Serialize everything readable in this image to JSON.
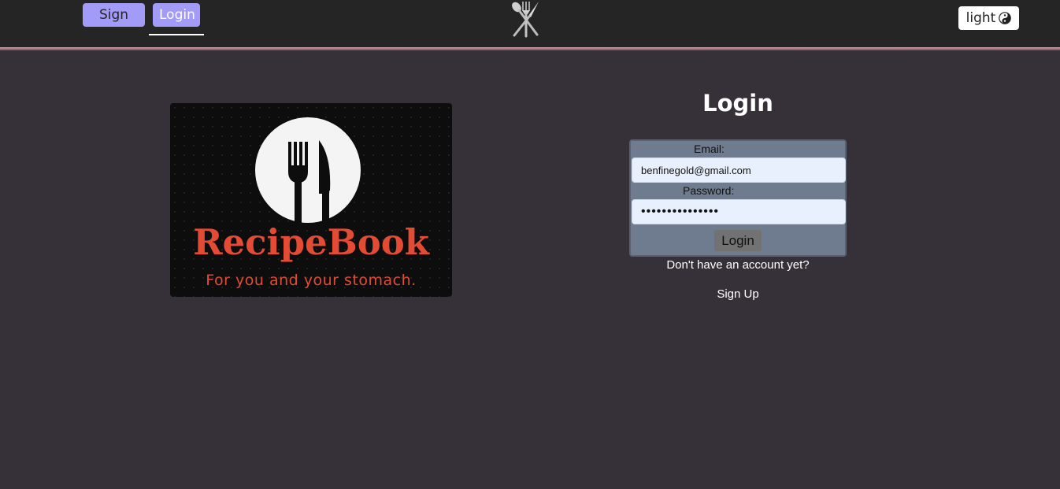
{
  "nav": {
    "signup_label": "Sign Up",
    "login_label": "Login",
    "logo_icon": "fork-knife-spoon-icon",
    "theme_label": "light",
    "theme_icon": "yin-yang-icon"
  },
  "brand": {
    "name": "RecipeBook",
    "tagline": "For you and your stomach.",
    "icon": "plate-fork-knife-icon",
    "accent_color": "#e34b34"
  },
  "login": {
    "title": "Login",
    "email_label": "Email:",
    "email_value": "benfinegold@gmail.com",
    "password_label": "Password:",
    "password_value": "•••••••••••••••",
    "submit_label": "Login",
    "no_account_text": "Don't have an account yet?",
    "signup_link": "Sign Up"
  },
  "colors": {
    "page_bg": "#363139",
    "navbar_bg": "#252525",
    "nav_button_bg": "#a29bf7",
    "form_bg": "#6f7b8e",
    "input_bg": "#e8f0fe"
  }
}
